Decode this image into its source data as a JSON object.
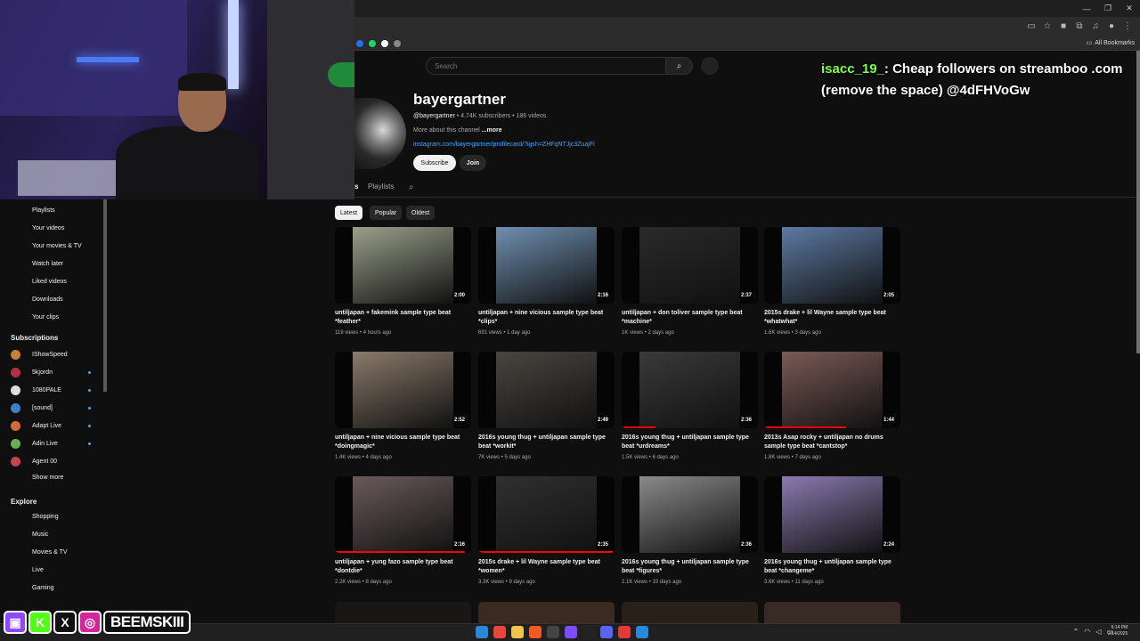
{
  "browser": {
    "win_controls": [
      "—",
      "❐",
      "✕"
    ],
    "bookmarks_label": "All Bookmarks",
    "favicon_colors": [
      "#1a73e8",
      "#25d366",
      "#ffffff",
      "#888888"
    ]
  },
  "search": {
    "placeholder": "Search"
  },
  "chat": {
    "username": "isacc_19_",
    "message": ": Cheap followers on streamboo .com (remove the space) @4dFHVoGw"
  },
  "channel": {
    "name": "bayergartner",
    "handle": "@bayergartner",
    "stats": " • 4.74K subscribers • 186 videos",
    "about": "More about this channel ",
    "about_more": "...more",
    "link": "instagram.com/bayergartner/profilecard/?igsh=ZHFqNTJjc3ZuajFi",
    "subscribe_label": "Subscribe",
    "join_label": "Join"
  },
  "tabs": {
    "partial": "s",
    "playlists": "Playlists"
  },
  "chips": [
    "Latest",
    "Popular",
    "Oldest"
  ],
  "sidebar": {
    "you_items": [
      "Playlists",
      "Your videos",
      "Your movies & TV",
      "Watch later",
      "Liked videos",
      "Downloads",
      "Your clips"
    ],
    "subscriptions_heading": "Subscriptions",
    "subscriptions": [
      {
        "name": "IShowSpeed",
        "color": "#c9803b",
        "live": false
      },
      {
        "name": "5kjordn",
        "color": "#b0304a",
        "live": true
      },
      {
        "name": "1080PALE",
        "color": "#dddddd",
        "live": true
      },
      {
        "name": "[sound]",
        "color": "#3b82c4",
        "live": true
      },
      {
        "name": "Adapt Live",
        "color": "#d46a3a",
        "live": true
      },
      {
        "name": "Adin Live",
        "color": "#6ab04c",
        "live": true
      },
      {
        "name": "Agent 00",
        "color": "#c04848",
        "live": false
      }
    ],
    "show_more": "Show more",
    "explore_heading": "Explore",
    "explore_items": [
      "Shopping",
      "Music",
      "Movies & TV",
      "Live",
      "Gaming"
    ]
  },
  "videos": [
    {
      "title": "untiljapan + fakemink sample type beat *feather*",
      "meta": "119 views • 4 hours ago",
      "duration": "2:00",
      "tint": "#9aa08a",
      "progress": 0
    },
    {
      "title": "untiljapan + nine vicious sample type beat *clips*",
      "meta": "691 views • 1 day ago",
      "duration": "2:16",
      "tint": "#6f8fb0",
      "progress": 0
    },
    {
      "title": "untiljapan + don toliver sample type beat *machine*",
      "meta": "1K views • 2 days ago",
      "duration": "2:37",
      "tint": "#2a2a2a",
      "progress": 0
    },
    {
      "title": "2015s drake + lil Wayne sample type beat *whatwhat*",
      "meta": "1.6K views • 3 days ago",
      "duration": "2:05",
      "tint": "#5d7aa3",
      "progress": 0
    },
    {
      "title": "untiljapan + nine vicious sample type beat *doingmagic*",
      "meta": "1.4K views • 4 days ago",
      "duration": "2:52",
      "tint": "#8a7a6a",
      "progress": 0
    },
    {
      "title": "2016s young thug + untiljapan sample type beat *workit*",
      "meta": "7K views • 5 days ago",
      "duration": "2:49",
      "tint": "#4a4540",
      "progress": 0
    },
    {
      "title": "2016s young thug + untiljapan sample type beat *urdreams*",
      "meta": "1.5K views • 6 days ago",
      "duration": "2:36",
      "tint": "#3a3a3a",
      "progress": 0.25
    },
    {
      "title": "2013s Asap rocky + untiljapan no drums sample type beat *cantstop*",
      "meta": "1.8K views • 7 days ago",
      "duration": "1:44",
      "tint": "#7a5a55",
      "progress": 0.6
    },
    {
      "title": "untiljapan + yung fazo sample type beat *dontdie*",
      "meta": "2.2K views • 8 days ago",
      "duration": "2:16",
      "tint": "#6a5a5a",
      "progress": 0.95
    },
    {
      "title": "2015s drake + lil Wayne sample type beat *women*",
      "meta": "3.3K views • 9 days ago",
      "duration": "2:35",
      "tint": "#303030",
      "progress": 1
    },
    {
      "title": "2016s young thug + untiljapan sample type beat *figures*",
      "meta": "2.1K views • 10 days ago",
      "duration": "2:36",
      "tint": "#8a8a8a",
      "progress": 0
    },
    {
      "title": "2016s young thug + untiljapan sample type beat *changeme*",
      "meta": "3.6K views • 11 days ago",
      "duration": "2:24",
      "tint": "#8a7ab0",
      "progress": 0
    }
  ],
  "overlay": {
    "streamer_name": "BEEMSKIII",
    "social_icons": [
      {
        "icon": "twitch-icon",
        "glyph": "▣",
        "color": "#9146ff"
      },
      {
        "icon": "kick-icon",
        "glyph": "K",
        "color": "#53fc18"
      },
      {
        "icon": "x-icon",
        "glyph": "X",
        "color": "#111111"
      },
      {
        "icon": "instagram-icon",
        "glyph": "◎",
        "color": "#d6249f"
      }
    ]
  },
  "taskbar": {
    "clock_time": "6:14 PM",
    "clock_date": "2/14/2025",
    "apps": [
      {
        "icon": "windows-icon",
        "color": "#2b88d8"
      },
      {
        "icon": "chrome-icon",
        "color": "#e8453c"
      },
      {
        "icon": "folder-icon",
        "color": "#f2c14e"
      },
      {
        "icon": "brave-icon",
        "color": "#f05a24"
      },
      {
        "icon": "obs-icon",
        "color": "#444444"
      },
      {
        "icon": "app-icon",
        "color": "#7c4dff"
      },
      {
        "icon": "tiktok-icon",
        "color": "#222222"
      },
      {
        "icon": "discord-icon",
        "color": "#5865f2"
      },
      {
        "icon": "app-icon",
        "color": "#e03a3a"
      },
      {
        "icon": "photos-icon",
        "color": "#2b88d8"
      }
    ]
  }
}
